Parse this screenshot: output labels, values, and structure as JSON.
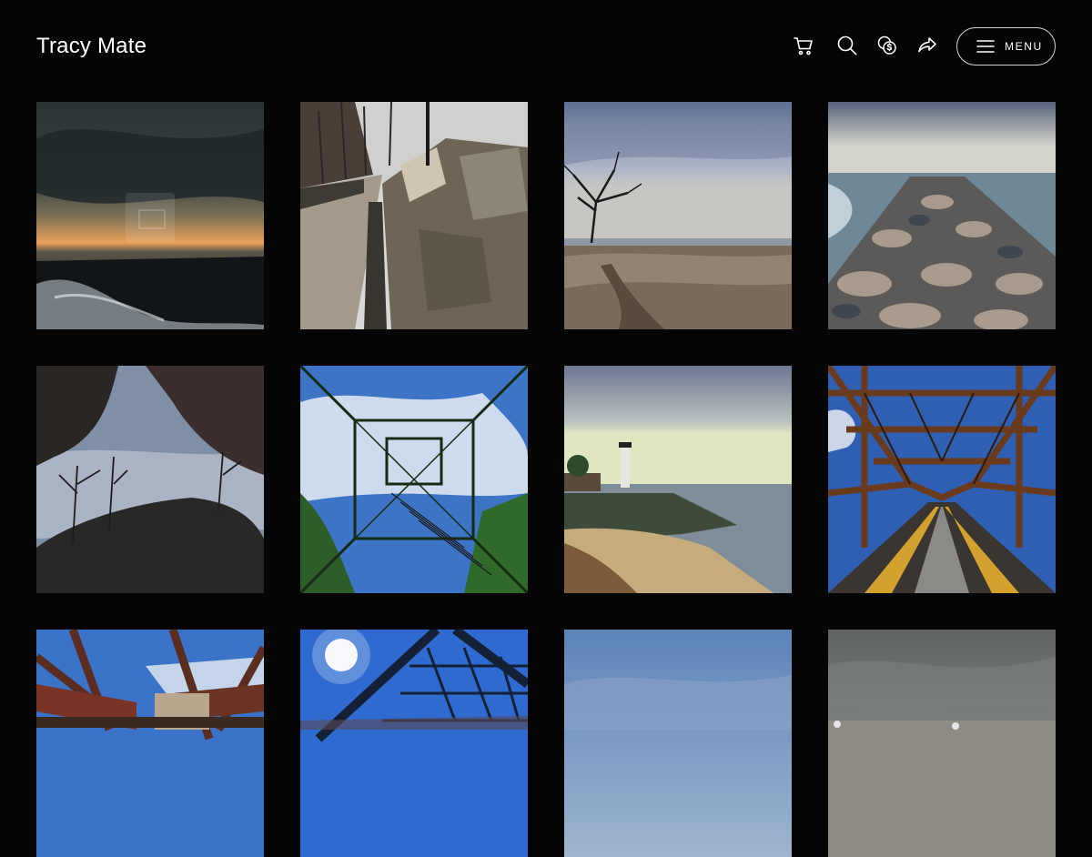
{
  "header": {
    "site_title": "Tracy Mate",
    "menu_label": "MENU",
    "icons": [
      "cart-icon",
      "search-icon",
      "coins-icon",
      "share-icon",
      "hamburger-icon"
    ]
  },
  "gallery": {
    "columns": 4,
    "photos": [
      {
        "name": "storm-over-waves"
      },
      {
        "name": "stone-wall-path"
      },
      {
        "name": "beach-tree-low-tide"
      },
      {
        "name": "rock-jetty"
      },
      {
        "name": "cave-view-trees"
      },
      {
        "name": "steel-tower-stairs"
      },
      {
        "name": "lighthouse-shore"
      },
      {
        "name": "rusty-railroad-bridge"
      },
      {
        "name": "bridge-underside"
      },
      {
        "name": "bridge-sun-burst"
      },
      {
        "name": "blue-sky-shore"
      },
      {
        "name": "cloudy-shoreline"
      }
    ]
  },
  "colors": {
    "background": "#050505",
    "text": "#ffffff",
    "button_border": "#d6d6d6"
  }
}
